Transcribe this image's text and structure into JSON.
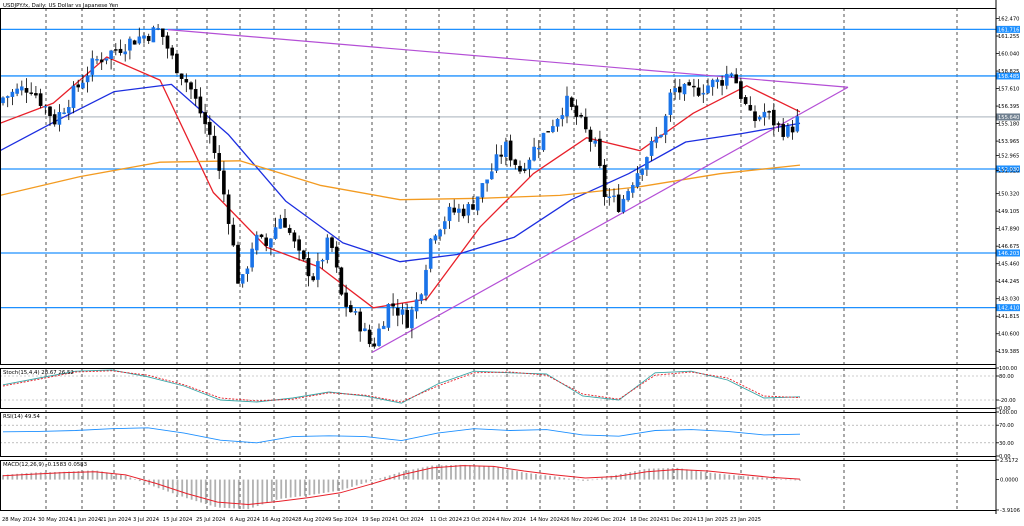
{
  "chart_data": [
    {
      "panel": "price",
      "type": "candlestick",
      "header": "USDJPY.fx, Daily:  US Dollar vs Japanese Yen",
      "ylim": [
        138.5,
        163.2
      ],
      "y_ticks": [
        "162.470",
        "161.255",
        "160.040",
        "158.825",
        "157.610",
        "156.395",
        "155.180",
        "153.965",
        "152.965",
        "151.920",
        "150.320",
        "149.105",
        "147.890",
        "146.675",
        "145.460",
        "144.245",
        "143.030",
        "141.815",
        "140.600",
        "139.385"
      ],
      "x_ticks": [
        "28 May 2024",
        "30 May 2024",
        "11 Jun 2024",
        "21 Jun 2024",
        "3 Jul 2024",
        "15 Jul 2024",
        "25 Jul 2024",
        "6 Aug 2024",
        "16 Aug 2024",
        "28 Aug 2024",
        "9 Sep 2024",
        "19 Sep 2024",
        "1 Oct 2024",
        "11 Oct 2024",
        "23 Oct 2024",
        "4 Nov 2024",
        "14 Nov 2024",
        "26 Nov 2024",
        "6 Dec 2024",
        "18 Dec 2024",
        "31 Dec 2024",
        "13 Jan 2025",
        "23 Jan 2025"
      ],
      "horizontal_levels": [
        {
          "value": 161.716,
          "label": "161.716",
          "color": "#1e90ff"
        },
        {
          "value": 158.485,
          "label": "158.485",
          "color": "#1e90ff"
        },
        {
          "value": 155.64,
          "label": "155.640",
          "color": "#708090"
        },
        {
          "value": 152.03,
          "label": "152.030",
          "color": "#1e90ff"
        },
        {
          "value": 146.203,
          "label": "146.203",
          "color": "#1e90ff"
        },
        {
          "value": 142.41,
          "label": "142.410",
          "color": "#1e90ff"
        }
      ],
      "key_points": {
        "start_close": 156.9,
        "peak_jul": 161.7,
        "low_aug": 142.0,
        "low_sep": 139.6,
        "high_nov": 156.7,
        "low_dec": 149.5,
        "high_jan": 158.9,
        "last_close": 155.6
      },
      "moving_averages": [
        {
          "color": "#e8202a",
          "values": [
            155.2,
            156.6,
            159.8,
            158.2,
            150.4,
            146.6,
            145.2,
            142.4,
            143.0,
            148.0,
            151.7,
            154.2,
            153.3,
            155.9,
            157.8,
            156.0
          ]
        },
        {
          "color": "#1c2ee0",
          "values": [
            153.3,
            155.4,
            157.4,
            157.9,
            154.4,
            149.8,
            146.9,
            145.6,
            146.1,
            147.3,
            149.9,
            151.7,
            153.9,
            154.5,
            155.2
          ]
        },
        {
          "color": "#f39b21",
          "values": [
            150.2,
            151.5,
            152.5,
            152.6,
            150.9,
            149.9,
            150.0,
            150.2,
            150.8,
            151.7,
            152.3
          ]
        }
      ],
      "trendlines": [
        {
          "color": "#b44fd6",
          "name": "upper"
        },
        {
          "color": "#b44fd6",
          "name": "lower"
        }
      ]
    },
    {
      "panel": "stochastic",
      "type": "line",
      "header": "Stoch(15,4,4) 28.67 26.52",
      "ylim": [
        0,
        100
      ],
      "y_ticks": [
        "100.00",
        "80.00",
        "-20.00",
        "0.00"
      ],
      "series": [
        {
          "values": [
            58,
            75,
            92,
            95,
            78,
            55,
            20,
            15,
            25,
            40,
            30,
            12,
            60,
            92,
            88,
            85,
            30,
            20,
            88,
            92,
            70,
            25,
            28
          ],
          "color": "#3aa6a6"
        },
        {
          "values": [
            55,
            72,
            90,
            93,
            82,
            58,
            25,
            18,
            22,
            38,
            32,
            15,
            55,
            88,
            90,
            82,
            35,
            22,
            82,
            90,
            75,
            30,
            26
          ],
          "color": "#e8202a"
        }
      ]
    },
    {
      "panel": "rsi",
      "type": "line",
      "header": "RSI(14) 49.54",
      "ylim": [
        0,
        100
      ],
      "y_ticks": [
        "100.00",
        "70.00",
        "30.00",
        "0.00"
      ],
      "series": [
        {
          "values": [
            55,
            56,
            58,
            62,
            64,
            52,
            36,
            30,
            44,
            46,
            44,
            35,
            52,
            62,
            58,
            60,
            48,
            45,
            58,
            60,
            56,
            48,
            49.5
          ],
          "color": "#1e90ff"
        }
      ]
    },
    {
      "panel": "macd",
      "type": "bar",
      "header": "MACD(12,26,9) -0.1583 0.0583",
      "ylim": [
        -3.9106,
        2.5172
      ],
      "y_ticks": [
        "2.5172",
        "0.0000",
        "-3.9106"
      ],
      "histogram": [
        0.6,
        0.9,
        1.0,
        1.2,
        0.5,
        -1.0,
        -2.4,
        -3.6,
        -3.8,
        -2.5,
        -2.0,
        -1.4,
        -0.2,
        1.0,
        1.8,
        1.9,
        1.7,
        0.9,
        0.4,
        -0.2,
        0.6,
        1.4,
        1.5,
        0.9,
        0.5,
        0.2,
        -0.15
      ],
      "signal": [
        0.5,
        0.7,
        0.9,
        1.0,
        0.6,
        -0.5,
        -1.8,
        -2.9,
        -3.2,
        -2.8,
        -2.3,
        -1.7,
        -0.6,
        0.6,
        1.5,
        1.8,
        1.7,
        1.1,
        0.6,
        0.2,
        0.4,
        1.0,
        1.3,
        1.1,
        0.7,
        0.3,
        0.06
      ]
    }
  ]
}
